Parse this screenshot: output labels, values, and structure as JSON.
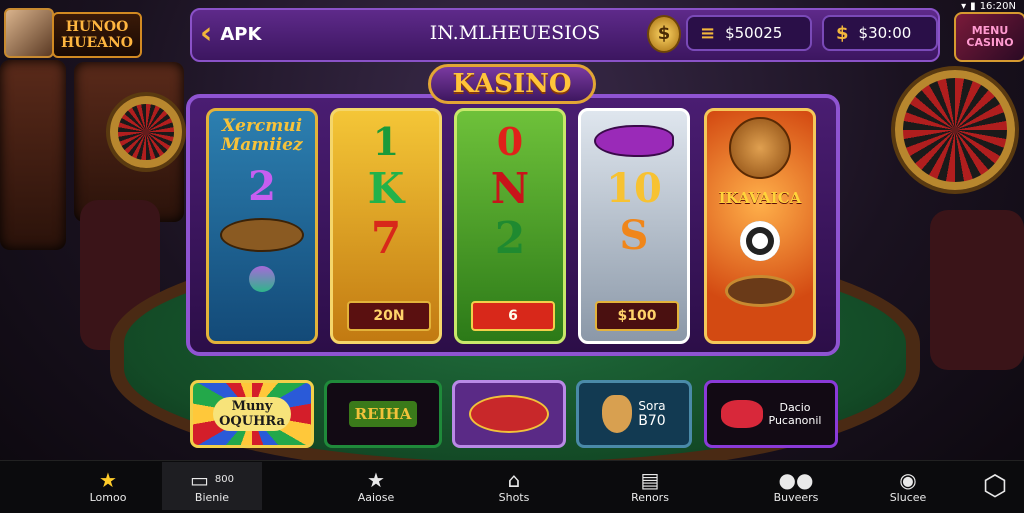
{
  "status_bar": {
    "time": "16:20N"
  },
  "header": {
    "brand": "HUNOO\nHUEANO",
    "back_label": "APK",
    "title": "IN.MLHEUESIOS",
    "coin_icon": "coin-icon",
    "balance_1": "$50025",
    "balance_2": "$30:00",
    "menu_thumb": "MENU\nCASINO"
  },
  "slot": {
    "banner": "KASINO",
    "reels": [
      {
        "top_text": "Xercmui\nMamiiez",
        "symbol_1": "2",
        "symbol_2": "turtle",
        "symbol_3": "ball"
      },
      {
        "symbol_1": "1",
        "symbol_2": "K",
        "symbol_3": "7",
        "payout": "20N"
      },
      {
        "symbol_1": "0",
        "symbol_2": "N",
        "symbol_3": "2",
        "payout": "6"
      },
      {
        "symbol_1": "fish",
        "symbol_2": "10",
        "symbol_3": "S",
        "payout": "$100"
      },
      {
        "symbol_1": "lion",
        "label": "IKAVAICA",
        "symbol_2": "dice",
        "symbol_3": "roulette"
      }
    ]
  },
  "tiles": [
    {
      "label": "Muny\nOQUHRa",
      "icon": "wheel-icon"
    },
    {
      "label": "REIHA"
    },
    {
      "label": "fish",
      "icon": "fish-icon"
    },
    {
      "label_1": "Sora",
      "label_2": "B70",
      "icon": "dog-icon"
    },
    {
      "label_1": "Dacio",
      "label_2": "Pucanonil",
      "icon": "dice-icon"
    }
  ],
  "nav": {
    "items": [
      {
        "label": "Lomoo",
        "icon": "star-icon"
      },
      {
        "label": "Bienie",
        "badge": "800",
        "icon": "card-icon"
      },
      {
        "label": "Aaiose",
        "icon": "star-outline-icon"
      },
      {
        "label": "Shots",
        "icon": "shots-icon"
      },
      {
        "label": "Renors",
        "icon": "screen-icon"
      },
      {
        "label": "Buveers",
        "icon": "users-icon"
      },
      {
        "label": "Slucee",
        "icon": "info-icon"
      },
      {
        "label": "",
        "icon": "settings-icon"
      }
    ]
  },
  "colors": {
    "accent": "#f1b53a",
    "panel": "#4a1d72",
    "felt": "#1f6a3a"
  }
}
